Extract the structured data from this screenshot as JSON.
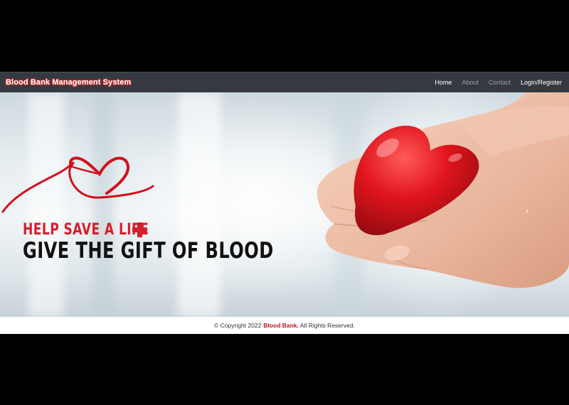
{
  "navbar": {
    "brand": "Blood Bank Management System",
    "links": [
      "Home",
      "About",
      "Contact",
      "Login/Register"
    ]
  },
  "hero": {
    "line1": "HELP SAVE A LIFE",
    "line2": "GIVE THE GIFT OF BLOOD",
    "prev_label": "‹",
    "next_label": "›"
  },
  "footer": {
    "prefix": "© Copyright 2022",
    "brand": "Blood Bank.",
    "suffix": "All Rights Reserved."
  },
  "colors": {
    "brand_glow": "#ff2a2a",
    "accent_red": "#d5202c",
    "navbar_bg": "#343a40"
  }
}
